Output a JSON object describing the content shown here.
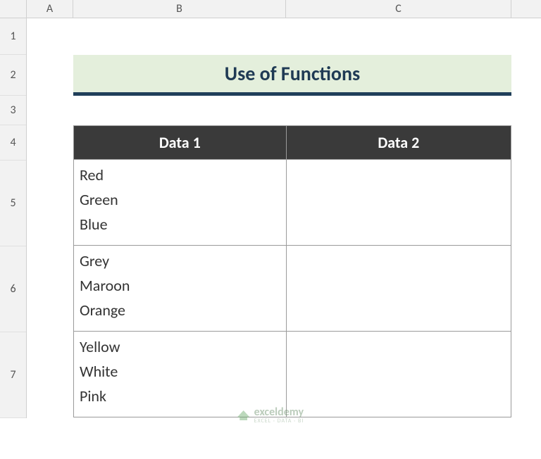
{
  "columns": [
    "A",
    "B",
    "C"
  ],
  "rows": [
    "1",
    "2",
    "3",
    "4",
    "5",
    "6",
    "7"
  ],
  "title": "Use of Functions",
  "table": {
    "headers": [
      "Data 1",
      "Data 2"
    ],
    "rows": [
      {
        "data1": "Red\nGreen\nBlue",
        "data2": ""
      },
      {
        "data1": "Grey\nMaroon\nOrange",
        "data2": ""
      },
      {
        "data1": "Yellow\nWhite\nPink",
        "data2": ""
      }
    ]
  },
  "watermark": {
    "main": "exceldemy",
    "sub": "EXCEL · DATA · BI"
  }
}
